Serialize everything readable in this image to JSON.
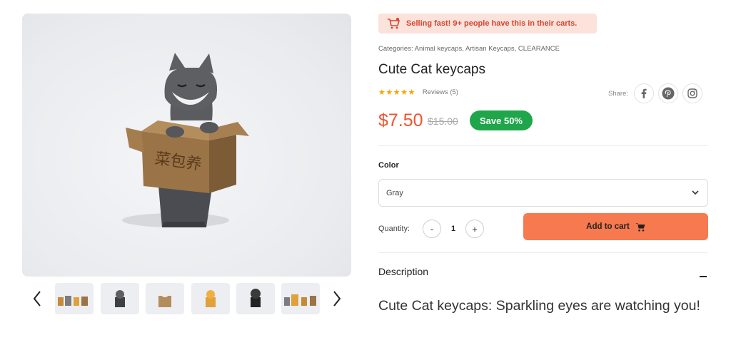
{
  "gallery": {
    "main_image_alt": "Cute Cat keycap",
    "box_text": "菜包养",
    "prev_label": "‹",
    "next_label": "›",
    "thumbnails": [
      "thumb-1",
      "thumb-2",
      "thumb-3",
      "thumb-4",
      "thumb-5",
      "thumb-6"
    ]
  },
  "alert": {
    "text": "Selling fast! 9+ people have this in their carts.",
    "icon": "cart-icon"
  },
  "product": {
    "categories_label": "Categories:",
    "categories": "Animal keycaps, Artisan Keycaps, CLEARANCE",
    "title": "Cute Cat keycaps",
    "stars": "★★★★★",
    "rating": 5,
    "reviews": "Reviews (5)",
    "price": "$7.50",
    "old_price": "$15.00",
    "save_badge": "Save 50%"
  },
  "share": {
    "label": "Share:",
    "networks": [
      "facebook-icon",
      "pinterest-icon",
      "instagram-icon"
    ]
  },
  "options": {
    "color_label": "Color",
    "color_value": "Gray",
    "quantity_label": "Quantity:",
    "quantity_value": "1",
    "minus": "-",
    "plus": "+",
    "add_to_cart": "Add to cart"
  },
  "description": {
    "title": "Description",
    "body": "Cute Cat keycaps: Sparkling eyes are watching you!"
  },
  "colors": {
    "accent": "#f6794f",
    "price": "#f0532f",
    "save_badge": "#1fa64a",
    "alert_bg": "#fbe3dc",
    "stars": "#f5a300"
  }
}
